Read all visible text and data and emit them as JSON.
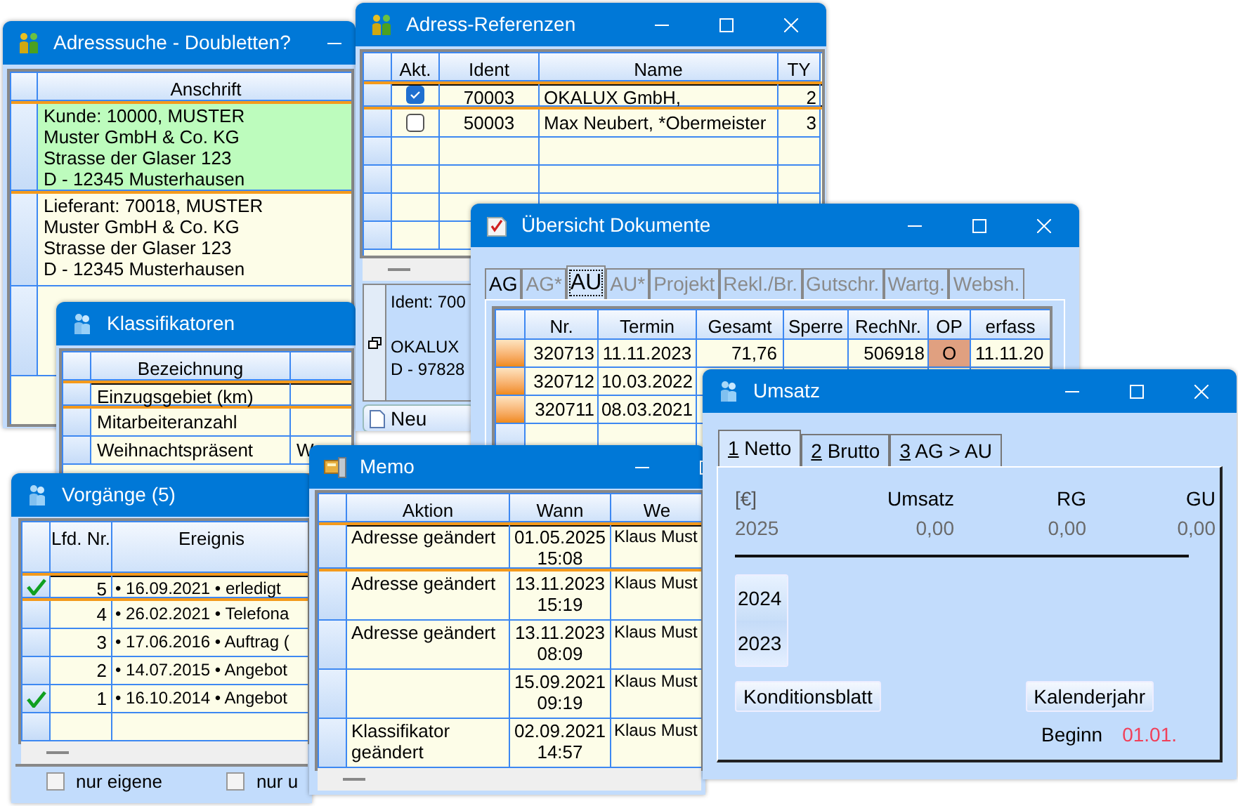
{
  "address_search": {
    "title": "Adresssuche - Doubletten?",
    "columns": [
      "Anschrift"
    ],
    "rows": [
      {
        "lines": [
          "Kunde: 10000, MUSTER",
          "Muster GmbH & Co. KG",
          "Strasse der Glaser 123",
          "D - 12345 Musterhausen"
        ],
        "selected": true,
        "highlighted": true
      },
      {
        "lines": [
          "Lieferant: 70018, MUSTER",
          "Muster GmbH & Co. KG",
          "Strasse der Glaser 123",
          "D - 12345 Musterhausen"
        ],
        "selected": false,
        "highlighted": false
      }
    ]
  },
  "classifiers": {
    "title": "Klassifikatoren",
    "columns": [
      "Bezeichnung"
    ],
    "rows": [
      {
        "label": "Einzugsgebiet (km)",
        "selected": true
      },
      {
        "label": "Mitarbeiteranzahl",
        "selected": false
      },
      {
        "label": "Weihnachtspräsent",
        "value": "W",
        "selected": false
      }
    ]
  },
  "address_references": {
    "title": "Adress-Referenzen",
    "columns": [
      "Akt.",
      "Ident",
      "Name",
      "TY"
    ],
    "rows": [
      {
        "checked": true,
        "ident": "70003",
        "name": "OKALUX GmbH,",
        "column_4": "2",
        "selected": true
      },
      {
        "checked": false,
        "ident": "50003",
        "name": "Max Neubert, *Obermeister",
        "column_4": "3",
        "selected": false
      }
    ],
    "detail_lines": [
      "Ident: 700",
      "OKALUX",
      "D - 97828"
    ],
    "new_button": "Neu"
  },
  "documents": {
    "title": "Übersicht Dokumente",
    "tabs": [
      {
        "label": "AG",
        "selected": false,
        "disabled": false
      },
      {
        "label": "AG*",
        "selected": false,
        "disabled": true
      },
      {
        "label": "AU",
        "selected": true,
        "disabled": false
      },
      {
        "label": "AU*",
        "selected": false,
        "disabled": true
      },
      {
        "label": "Projekt",
        "selected": false,
        "disabled": true
      },
      {
        "label": "Rekl./Br.",
        "selected": false,
        "disabled": true
      },
      {
        "label": "Gutschr.",
        "selected": false,
        "disabled": true
      },
      {
        "label": "Wartg.",
        "selected": false,
        "disabled": true
      },
      {
        "label": "Websh.",
        "selected": false,
        "disabled": true
      }
    ],
    "columns": [
      "Nr.",
      "Termin",
      "Gesamt",
      "Sperre",
      "RechNr.",
      "OP",
      "erfass"
    ],
    "rows": [
      {
        "nr": "320713",
        "termin": "11.11.2023",
        "gesamt": "71,76",
        "rechnr": "506918",
        "op": "O",
        "column_7": "11.11.20",
        "open_item": true
      },
      {
        "nr": "320712",
        "termin": "10.03.2022"
      },
      {
        "nr": "320711",
        "termin": "08.03.2021"
      }
    ]
  },
  "processes": {
    "title": "Vorgänge (5)",
    "columns": [
      "Lfd. Nr.",
      "Ereignis"
    ],
    "rows": [
      {
        "no": "5",
        "event": "• 16.09.2021 • erledigt",
        "done": true,
        "selected": true
      },
      {
        "no": "4",
        "event": "• 26.02.2021 • Telefona",
        "done": false,
        "selected": false
      },
      {
        "no": "3",
        "event": "• 17.06.2016 • Auftrag (",
        "done": false,
        "selected": false
      },
      {
        "no": "2",
        "event": "• 14.07.2015 • Angebot",
        "done": false,
        "selected": false
      },
      {
        "no": "1",
        "event": "• 16.10.2014 • Angebot",
        "done": true,
        "selected": false
      }
    ],
    "filters": [
      {
        "label": "nur eigene",
        "checked": false
      },
      {
        "label": "nur u",
        "checked": false
      }
    ]
  },
  "memo": {
    "title": "Memo",
    "columns": [
      "Aktion",
      "Wann",
      "We"
    ],
    "rows": [
      {
        "action": "Adresse geändert",
        "when": "01.05.2025 15:08",
        "who": "Klaus Must",
        "selected": true
      },
      {
        "action": "Adresse geändert",
        "when": "13.11.2023 15:19",
        "who": "Klaus Must",
        "selected": false
      },
      {
        "action": "Adresse geändert",
        "when": "13.11.2023 08:09",
        "who": "Klaus Must",
        "selected": false
      },
      {
        "when": "15.09.2021 09:19",
        "who": "Klaus Must",
        "selected": false
      },
      {
        "action": "Klassifikator geändert",
        "when": "02.09.2021 14:57",
        "who": "Klaus Must",
        "selected": false
      }
    ]
  },
  "revenue": {
    "title": "Umsatz",
    "tabs": [
      {
        "key": "1",
        "label": "Netto",
        "selected": true
      },
      {
        "key": "2",
        "label": "Brutto",
        "selected": false
      },
      {
        "key": "3",
        "label": "AG > AU",
        "selected": false
      }
    ],
    "headers": [
      "[€]",
      "Umsatz",
      "RG",
      "GU"
    ],
    "current_row": [
      "2025",
      "0,00",
      "0,00",
      "0,00"
    ],
    "years": [
      "2024",
      "2023"
    ],
    "buttons": [
      "Konditionsblatt",
      "Kalenderjahr"
    ],
    "start_label": "Beginn",
    "start_value": "01.01."
  }
}
